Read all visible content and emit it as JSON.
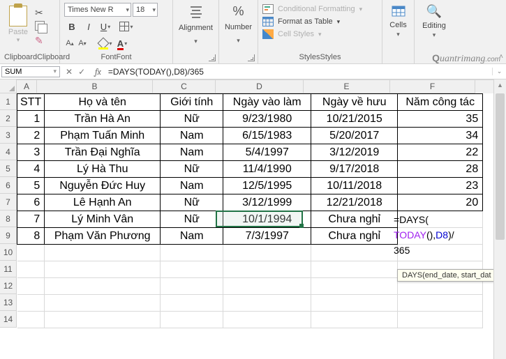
{
  "ribbon": {
    "clipboard": {
      "label": "Clipboard",
      "paste": "Paste"
    },
    "font": {
      "label": "Font",
      "name": "Times New R",
      "size": "18"
    },
    "alignment": {
      "label": "Alignment"
    },
    "number": {
      "label": "Number"
    },
    "styles": {
      "label": "Styles",
      "conditional": "Conditional Formatting",
      "table": "Format as Table",
      "cell": "Cell Styles"
    },
    "cells": {
      "label": "Cells"
    },
    "editing": {
      "label": "Editing"
    }
  },
  "watermark": "Quantrimang.com",
  "namebox": "SUM",
  "formula": "=DAYS(TODAY(),D8)/365",
  "tooltip": "DAYS(end_date, start_dat",
  "formula_overlay": {
    "line1_pre": "=DAYS(",
    "line2_func": "TODAY",
    "line2_paren": "(),",
    "line2_ref": "D8",
    "line2_post": ")/",
    "line3": "365"
  },
  "columns": [
    "A",
    "B",
    "C",
    "D",
    "E",
    "F"
  ],
  "rows": [
    "1",
    "2",
    "3",
    "4",
    "5",
    "6",
    "7",
    "8",
    "9",
    "10",
    "11",
    "12",
    "13",
    "14"
  ],
  "headers": {
    "stt": "STT",
    "name": "Họ và tên",
    "gender": "Giới tính",
    "join": "Ngày vào làm",
    "retire": "Ngày về hưu",
    "years": "Năm công tác"
  },
  "table_data": [
    {
      "stt": "1",
      "name": "Trần Hà An",
      "gender": "Nữ",
      "join": "9/23/1980",
      "retire": "10/21/2015",
      "years": "35"
    },
    {
      "stt": "2",
      "name": "Phạm Tuấn Minh",
      "gender": "Nam",
      "join": "6/15/1983",
      "retire": "5/20/2017",
      "years": "34"
    },
    {
      "stt": "3",
      "name": "Trần Đại Nghĩa",
      "gender": "Nam",
      "join": "5/4/1997",
      "retire": "3/12/2019",
      "years": "22"
    },
    {
      "stt": "4",
      "name": "Lý Hà Thu",
      "gender": "Nữ",
      "join": "11/4/1990",
      "retire": "9/17/2018",
      "years": "28"
    },
    {
      "stt": "5",
      "name": "Nguyễn Đức Huy",
      "gender": "Nam",
      "join": "12/5/1995",
      "retire": "10/11/2018",
      "years": "23"
    },
    {
      "stt": "6",
      "name": "Lê Hạnh An",
      "gender": "Nữ",
      "join": "3/12/1999",
      "retire": "12/21/2018",
      "years": "20"
    },
    {
      "stt": "7",
      "name": "Lý Minh Vân",
      "gender": "Nữ",
      "join": "10/1/1994",
      "retire": "Chưa nghỉ",
      "years": ""
    },
    {
      "stt": "8",
      "name": "Phạm Văn Phương",
      "gender": "Nam",
      "join": "7/3/1997",
      "retire": "Chưa nghỉ",
      "years": ""
    }
  ],
  "chart_data": {
    "type": "table",
    "title": "",
    "columns": [
      "STT",
      "Họ và tên",
      "Giới tính",
      "Ngày vào làm",
      "Ngày về hưu",
      "Năm công tác"
    ],
    "rows": [
      [
        "1",
        "Trần Hà An",
        "Nữ",
        "9/23/1980",
        "10/21/2015",
        35
      ],
      [
        "2",
        "Phạm Tuấn Minh",
        "Nam",
        "6/15/1983",
        "5/20/2017",
        34
      ],
      [
        "3",
        "Trần Đại Nghĩa",
        "Nam",
        "5/4/1997",
        "3/12/2019",
        22
      ],
      [
        "4",
        "Lý Hà Thu",
        "Nữ",
        "11/4/1990",
        "9/17/2018",
        28
      ],
      [
        "5",
        "Nguyễn Đức Huy",
        "Nam",
        "12/5/1995",
        "10/11/2018",
        23
      ],
      [
        "6",
        "Lê Hạnh An",
        "Nữ",
        "3/12/1999",
        "12/21/2018",
        20
      ],
      [
        "7",
        "Lý Minh Vân",
        "Nữ",
        "10/1/1994",
        "Chưa nghỉ",
        null
      ],
      [
        "8",
        "Phạm Văn Phương",
        "Nam",
        "7/3/1997",
        "Chưa nghỉ",
        null
      ]
    ]
  }
}
